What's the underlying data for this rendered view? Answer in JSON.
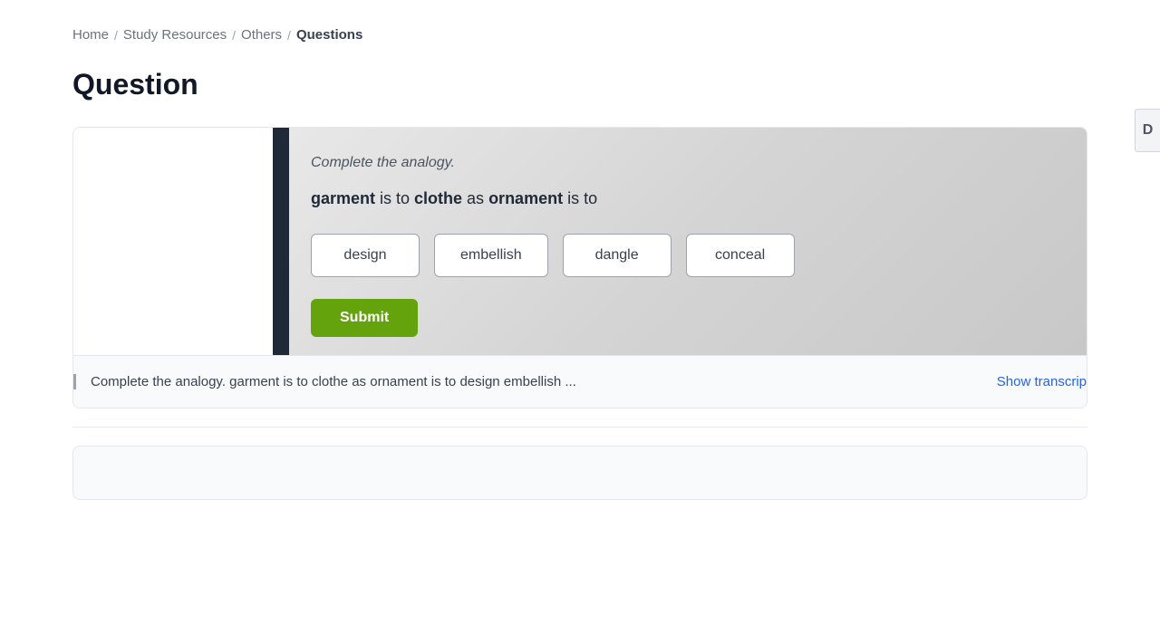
{
  "breadcrumb": {
    "items": [
      {
        "label": "Home",
        "active": false
      },
      {
        "label": "Study Resources",
        "active": false
      },
      {
        "label": "Others",
        "active": false
      },
      {
        "label": "Questions",
        "active": true
      }
    ],
    "separators": [
      "/",
      "/",
      "/"
    ]
  },
  "page": {
    "title": "Question"
  },
  "right_panel_button": {
    "label": "D"
  },
  "question": {
    "instruction": "Complete the analogy.",
    "analogy": {
      "word1": "garment",
      "connector1": " is to ",
      "word2": "clothe",
      "connector2": " as ",
      "word3": "ornament",
      "connector3": " is to"
    },
    "options": [
      {
        "label": "design"
      },
      {
        "label": "embellish"
      },
      {
        "label": "dangle"
      },
      {
        "label": "conceal"
      }
    ],
    "submit_label": "Submit"
  },
  "transcript": {
    "text": "Complete the analogy. garment is to clothe as ornament is to design embellish ...",
    "show_label": "Show transcrip"
  }
}
